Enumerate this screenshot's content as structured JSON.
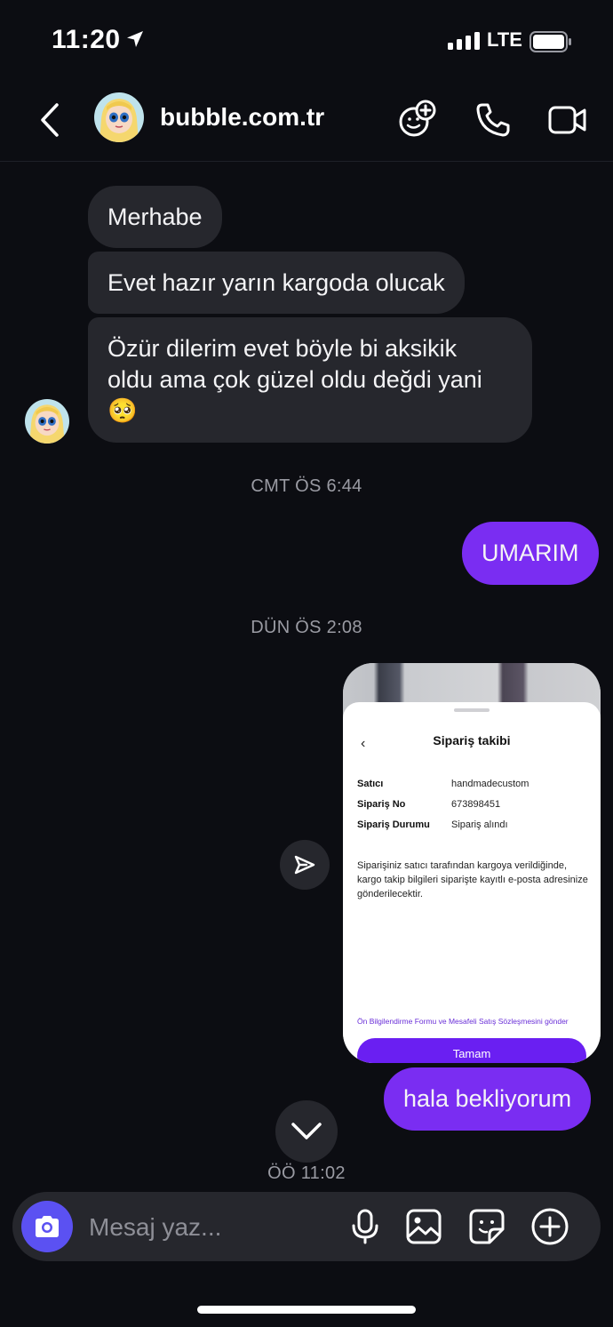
{
  "status_bar": {
    "time": "11:20",
    "network": "LTE"
  },
  "header": {
    "contact_name": "bubble.com.tr"
  },
  "messages": {
    "in_1": "Merhabe",
    "in_2": "Evet hazır yarın kargoda olucak",
    "in_3_line1": "Özür dilerim evet böyle bi aksikik",
    "in_3_line2": "oldu ama çok güzel oldu değdi yani",
    "in_3_emoji": "🥺",
    "timestamp_1": "CMT ÖS 6:44",
    "out_1": "UMARIM",
    "timestamp_2": "DÜN ÖS 2:08",
    "out_2": "hala bekliyorum",
    "timestamp_3": "ÖÖ 11:02"
  },
  "shared_card": {
    "title": "Sipariş takibi",
    "back_glyph": "‹",
    "rows": [
      {
        "label": "Satıcı",
        "value": "handmadecustom"
      },
      {
        "label": "Sipariş No",
        "value": "673898451"
      },
      {
        "label": "Sipariş Durumu",
        "value": "Sipariş alındı"
      }
    ],
    "description": "Siparişiniz satıcı tarafından kargoya verildiğinde, kargo takip bilgileri siparişte kayıtlı e-posta adresinize gönderilecektir.",
    "link": "Ön Bilgilendirme Formu ve Mesafeli Satış Sözleşmesini gönder",
    "button": "Tamam"
  },
  "composer": {
    "placeholder": "Mesaj yaz..."
  },
  "colors": {
    "background": "#0c0d12",
    "incoming_bubble": "#26272d",
    "outgoing_bubble": "#7a2df2",
    "camera_button": "#5b51f2",
    "card_button": "#6a1ff2"
  },
  "icons": {
    "status": [
      "location-arrow-icon",
      "signal-icon",
      "battery-icon"
    ],
    "header": [
      "back-chevron-icon",
      "add-face-icon",
      "phone-icon",
      "video-camera-icon"
    ],
    "composer": [
      "camera-icon",
      "microphone-icon",
      "image-icon",
      "sticker-icon",
      "plus-circle-icon"
    ],
    "chat": [
      "share-send-icon",
      "chevron-down-icon"
    ]
  }
}
